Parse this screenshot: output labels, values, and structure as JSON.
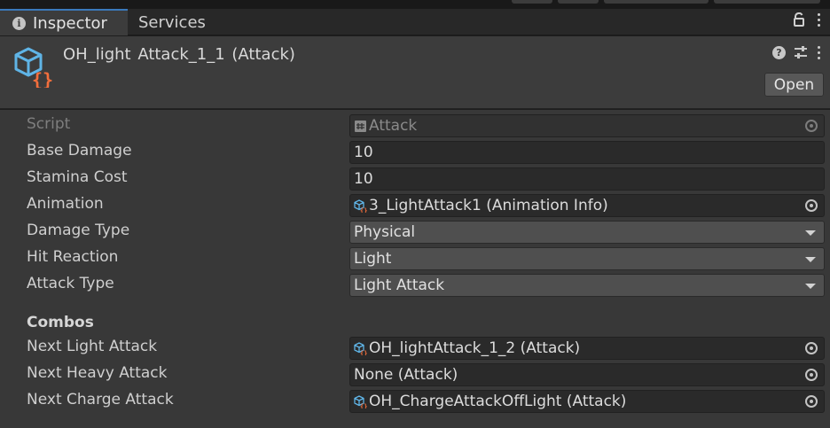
{
  "tabs": {
    "inspector": "Inspector",
    "services": "Services"
  },
  "header": {
    "title": "OH_light Attack_1_1 (Attack)",
    "open_button": "Open",
    "icons": [
      "scriptable-object-icon",
      "help-icon",
      "preset-icon",
      "kebab-menu-icon",
      "lock-icon"
    ]
  },
  "fields": {
    "script": {
      "label": "Script",
      "value": "Attack"
    },
    "base_damage": {
      "label": "Base Damage",
      "value": "10"
    },
    "stamina_cost": {
      "label": "Stamina Cost",
      "value": "10"
    },
    "animation": {
      "label": "Animation",
      "value": "3_LightAttack1 (Animation Info)"
    },
    "damage_type": {
      "label": "Damage Type",
      "value": "Physical"
    },
    "hit_reaction": {
      "label": "Hit Reaction",
      "value": "Light"
    },
    "attack_type": {
      "label": "Attack Type",
      "value": "Light Attack"
    }
  },
  "combos": {
    "header": "Combos",
    "next_light": {
      "label": "Next Light Attack",
      "value": "OH_lightAttack_1_2 (Attack)"
    },
    "next_heavy": {
      "label": "Next Heavy Attack",
      "value": "None (Attack)"
    },
    "next_charge": {
      "label": "Next Charge Attack",
      "value": "OH_ChargeAttackOffLight (Attack)"
    }
  },
  "colors": {
    "accent_tab": "#3a79bb",
    "icon_cube": "#5fb4e6",
    "icon_braces": "#f36e3c"
  }
}
